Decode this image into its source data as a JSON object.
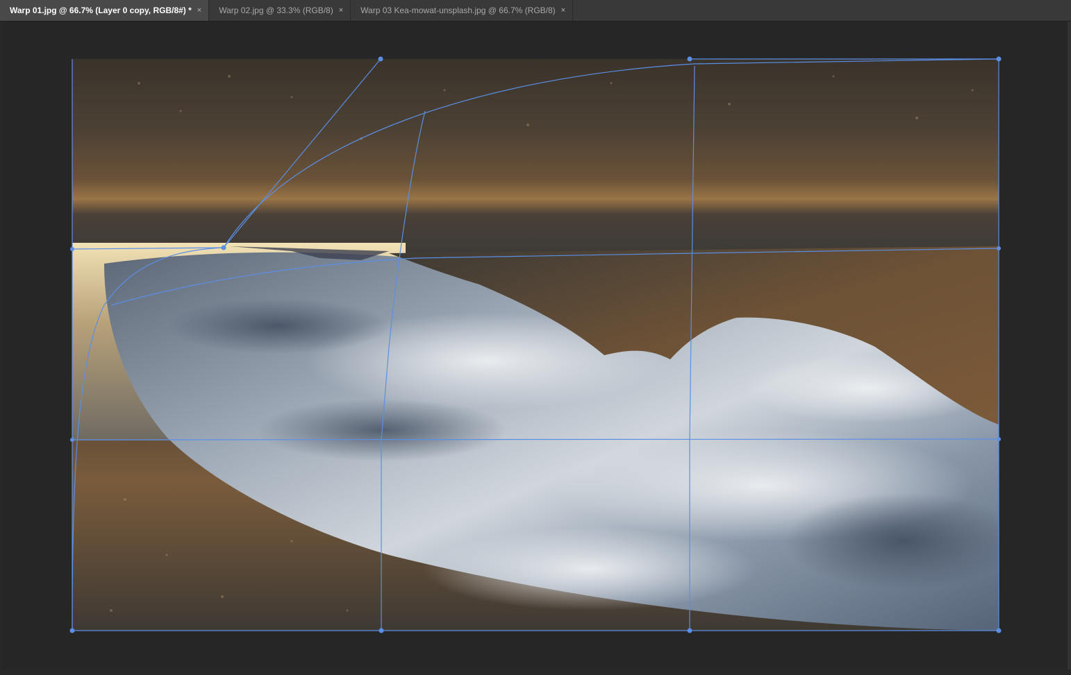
{
  "tabs": [
    {
      "label": "Warp 01.jpg @ 66.7% (Layer 0 copy, RGB/8#) *",
      "active": true
    },
    {
      "label": "Warp 02.jpg @ 33.3% (RGB/8)",
      "active": false
    },
    {
      "label": "Warp 03 Kea-mowat-unsplash.jpg @ 66.7% (RGB/8)",
      "active": false
    }
  ],
  "close_glyph": "×",
  "colors": {
    "ui_bg": "#282828",
    "tab_bg": "#393939",
    "tab_active_bg": "#494949",
    "warp_handle": "#5b8fe6"
  }
}
